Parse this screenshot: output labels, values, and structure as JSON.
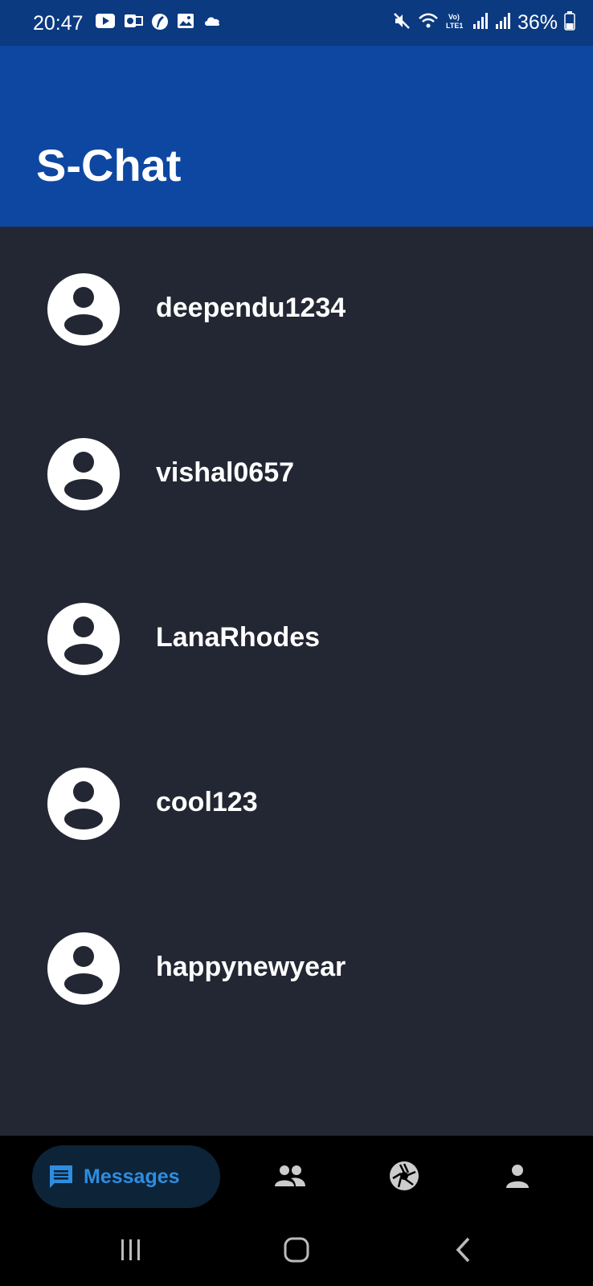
{
  "status_bar": {
    "time": "20:47",
    "battery": "36%",
    "left_icons": [
      "youtube-icon",
      "outlook-icon",
      "feather-app-icon",
      "gallery-icon",
      "cloud-icon"
    ],
    "right_icons": [
      "mute-icon",
      "wifi-icon",
      "volte-icon",
      "signal-icon",
      "signal-icon",
      "battery-icon"
    ]
  },
  "app_bar": {
    "title": "S-Chat"
  },
  "contacts": [
    {
      "name": "deependu1234"
    },
    {
      "name": "vishal0657"
    },
    {
      "name": "LanaRhodes"
    },
    {
      "name": "cool123"
    },
    {
      "name": "happynewyear"
    }
  ],
  "bottom_nav": {
    "active_label": "Messages",
    "items": [
      "messages-icon",
      "people-icon",
      "camera-aperture-icon",
      "profile-icon"
    ]
  },
  "system_nav": [
    "recents-icon",
    "home-icon",
    "back-icon"
  ],
  "colors": {
    "status_bar": "#0b3a80",
    "app_bar": "#0d47a1",
    "background": "#232733",
    "nav_bar": "#000000",
    "nav_active_pill": "#0d2338",
    "accent": "#2e8de0"
  }
}
